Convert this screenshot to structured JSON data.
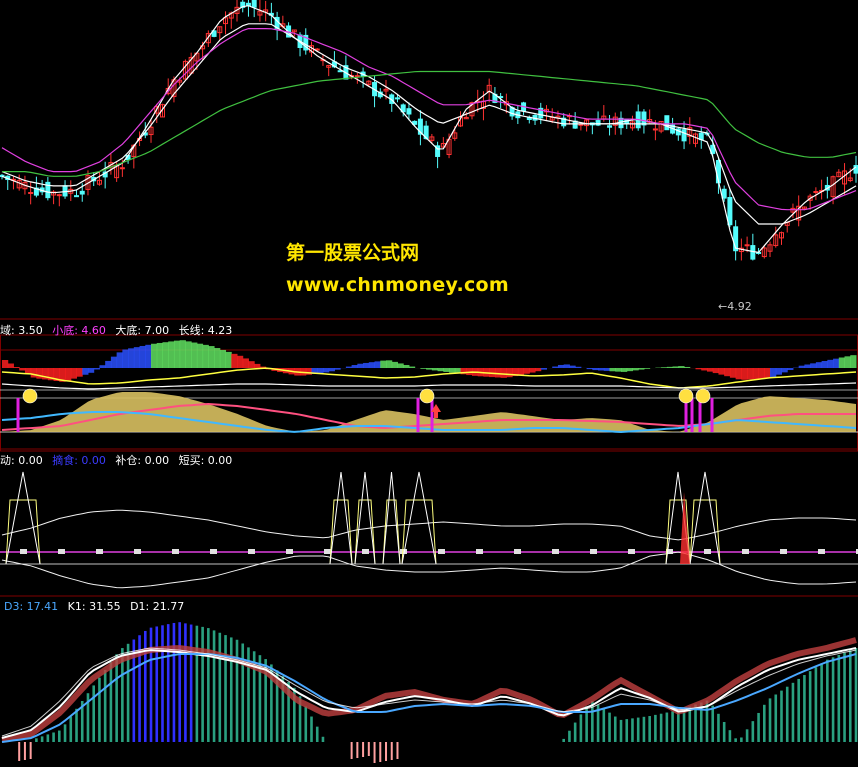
{
  "watermark": {
    "line1": "第一股票公式网",
    "line2": "www.chnmoney.com"
  },
  "price_panel": {
    "low_label": "←4.92"
  },
  "panel2": {
    "label_0": "域: 3.50",
    "label_1": "小底: 4.60",
    "label_2": "大底: 7.00",
    "label_3": "长线: 4.23",
    "colors": [
      "#ffffff",
      "#ff40ff",
      "#ffffff",
      "#ffffff"
    ]
  },
  "panel3": {
    "label_0": "动: 0.00",
    "label_1": "摘食: 0.00",
    "label_2": "补仓: 0.00",
    "label_3": "短买: 0.00",
    "colors": [
      "#ffffff",
      "#3b3bff",
      "#ffffff",
      "#ffffff"
    ]
  },
  "panel4": {
    "label_0": "D3: 17.41",
    "label_1": "K1: 31.55",
    "label_2": "D1: 21.77",
    "colors": [
      "#4aa8ff",
      "#ffffff",
      "#ffffff"
    ]
  },
  "colors": {
    "up": "#ff3232",
    "down": "#54fcfc",
    "ma_white": "#ffffff",
    "ma_magenta": "#e040e0",
    "ma_green": "#40c040",
    "yellow": "#ffff40",
    "panel_border": "#800000"
  },
  "chart_data": [
    {
      "type": "candlestick",
      "title": "",
      "series": [
        {
          "name": "",
          "values": [
            7.3,
            7.1,
            6.95,
            7.0,
            7.3,
            7.6,
            8.4,
            9.3,
            9.9,
            10.6,
            10.9,
            10.7,
            10.2,
            9.8,
            9.5,
            9.2,
            8.9,
            8.3,
            7.8,
            8.7,
            9.1,
            8.7,
            8.6,
            8.5,
            8.4,
            8.4,
            8.5,
            8.4,
            8.2,
            8.0,
            5.8,
            5.7,
            6.3,
            6.8,
            7.1,
            7.5
          ]
        },
        {
          "name": "",
          "values": [
            7.4,
            7.2,
            7.1,
            7.1,
            7.4,
            7.7,
            8.3,
            9.0,
            9.6,
            10.2,
            10.5,
            10.5,
            10.2,
            9.9,
            9.6,
            9.4,
            9.1,
            8.7,
            8.4,
            8.6,
            8.8,
            8.6,
            8.5,
            8.4,
            8.4,
            8.4,
            8.4,
            8.4,
            8.3,
            8.2,
            6.8,
            6.3,
            6.3,
            6.5,
            6.8,
            7.1
          ]
        },
        {
          "name": "",
          "values": [
            7.9,
            7.6,
            7.4,
            7.4,
            7.6,
            8.0,
            8.6,
            9.2,
            9.7,
            10.1,
            10.4,
            10.4,
            10.3,
            10.1,
            9.9,
            9.6,
            9.4,
            9.1,
            8.8,
            8.8,
            8.9,
            8.8,
            8.7,
            8.6,
            8.5,
            8.5,
            8.5,
            8.4,
            8.4,
            8.3,
            7.2,
            6.7,
            6.6,
            6.6,
            6.8,
            7.0
          ]
        },
        {
          "name": "",
          "values": [
            7.4,
            7.4,
            7.3,
            7.3,
            7.4,
            7.6,
            7.8,
            8.1,
            8.4,
            8.7,
            8.9,
            9.1,
            9.2,
            9.3,
            9.35,
            9.4,
            9.45,
            9.5,
            9.5,
            9.5,
            9.5,
            9.45,
            9.4,
            9.35,
            9.3,
            9.25,
            9.2,
            9.1,
            9.0,
            8.9,
            8.3,
            8.0,
            7.8,
            7.7,
            7.7,
            7.8
          ]
        }
      ],
      "low_price": 4.92
    },
    {
      "type": "area",
      "labels": [
        "域",
        "小底",
        "大底",
        "长线"
      ],
      "values": [
        3.5,
        4.6,
        7.0,
        4.23
      ]
    },
    {
      "type": "line",
      "labels": [
        "动",
        "摘食",
        "补仓",
        "短买"
      ],
      "values": [
        0.0,
        0.0,
        0.0,
        0.0
      ]
    },
    {
      "type": "bar",
      "labels": [
        "D3",
        "K1",
        "D1"
      ],
      "values": [
        17.41,
        31.55,
        21.77
      ]
    }
  ]
}
